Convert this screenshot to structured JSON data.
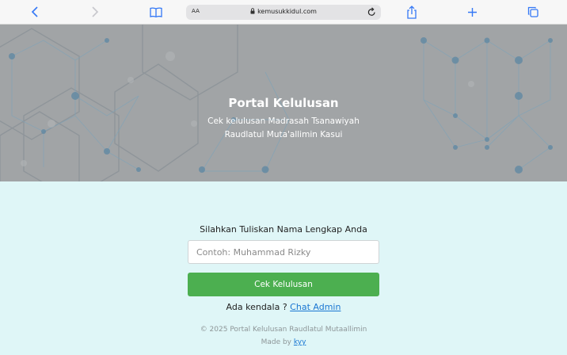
{
  "browser": {
    "text_size_label": "AA",
    "url": "kemusukkidul.com",
    "icons": [
      "back-icon",
      "forward-icon",
      "bookmarks-icon",
      "lock-icon",
      "reload-icon",
      "share-icon",
      "new-tab-icon",
      "tabs-icon"
    ]
  },
  "hero": {
    "title": "Portal Kelulusan",
    "subtitle_line1": "Cek kelulusan Madrasah Tsanawiyah",
    "subtitle_line2": "Raudlatul Muta'allimin Kasui"
  },
  "form": {
    "label": "Silahkan Tuliskan Nama Lengkap Anda",
    "name_placeholder": "Contoh: Muhammad Rizky",
    "name_value": "",
    "submit_label": "Cek Kelulusan",
    "help_text": "Ada kendala ? ",
    "help_link": "Chat Admin"
  },
  "footer": {
    "copyright": "© 2025 Portal Kelulusan Raudlatul Mutaallimin",
    "made_by": "Made by ",
    "author": "kyy"
  },
  "colors": {
    "accent": "#3478f6",
    "button": "#4caf50",
    "link": "#1976d2",
    "page_bg": "#dff6f7",
    "hero_bg": "#a1a4a6"
  }
}
